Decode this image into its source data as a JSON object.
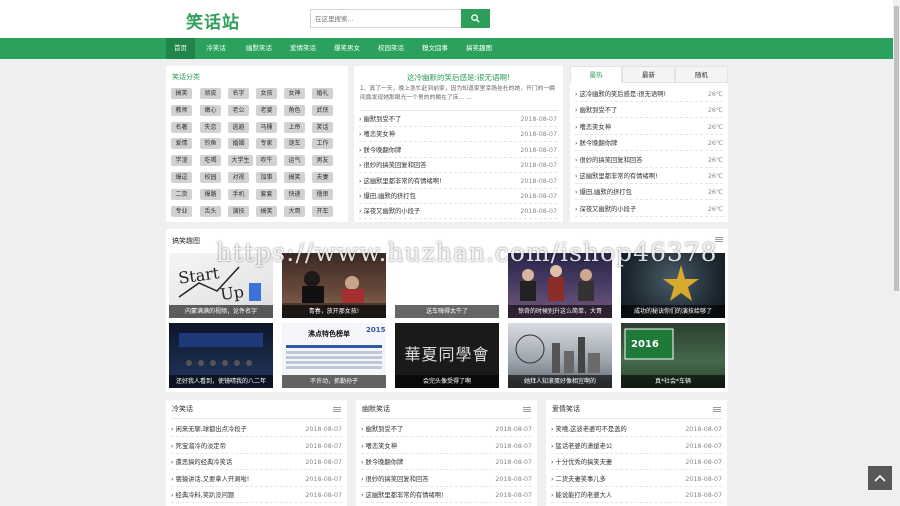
{
  "header": {
    "logo": "笑话站",
    "search_placeholder": "在这里搜索..."
  },
  "nav": [
    "首页",
    "冷笑话",
    "幽默笑话",
    "爱情笑话",
    "爆笑男女",
    "校园笑话",
    "糗文囧事",
    "搞笑趣图"
  ],
  "categories": {
    "title": "笑话分类",
    "tags": [
      [
        "搞笑",
        "顽皮",
        "名字",
        "女孩",
        "女神",
        "婚礼"
      ],
      [
        "教师",
        "嫩心",
        "老公",
        "老婆",
        "角色",
        "武侠"
      ],
      [
        "名著",
        "失恋",
        "逃避",
        "马桶",
        "上帝",
        "笑话"
      ],
      [
        "爱情",
        "钓鱼",
        "婚姻",
        "专家",
        "谜车",
        "工作"
      ],
      [
        "学渣",
        "吃喝",
        "大学生",
        "吹牛",
        "运气",
        "男友"
      ],
      [
        "爆逗",
        "校园",
        "对视",
        "加事",
        "搞笑",
        "夫妻"
      ],
      [
        "二货",
        "爆路",
        "手机",
        "套套",
        "快递",
        "撸串"
      ],
      [
        "专业",
        "舌头",
        "演技",
        "搞笑",
        "大哥",
        "开车"
      ]
    ]
  },
  "featured": {
    "title": "这冷幽默的笑后感是:很无语啊!",
    "summary": "1、真了一天，晚上急忙赶到前家，因为知道家里幸肠挂杜的她，开门的一瞬间竟发现她那眼光一个男的的躺在了床… …",
    "items": [
      {
        "title": "幽默到受不了",
        "date": "2018-08-07"
      },
      {
        "title": "嗜恋笑女神",
        "date": "2018-08-07"
      },
      {
        "title": "朕今晚翻你牌",
        "date": "2018-08-07"
      },
      {
        "title": "很妙的搞笑回复和回答",
        "date": "2018-08-07"
      },
      {
        "title": "这幽默里都非常的有情绪啊!",
        "date": "2018-08-07"
      },
      {
        "title": "爆田,幽默的挤打包",
        "date": "2018-08-07"
      },
      {
        "title": "深夜又幽默的小段子",
        "date": "2018-08-07"
      }
    ]
  },
  "rank": {
    "tabs": [
      "最热",
      "最新",
      "随机"
    ],
    "items": [
      {
        "title": "这冷幽默的笑后感是:很无语啊!",
        "temp": "26℃"
      },
      {
        "title": "幽默到受不了",
        "temp": "26℃"
      },
      {
        "title": "嗜恋笑女神",
        "temp": "26℃"
      },
      {
        "title": "朕今晚翻你牌",
        "temp": "26℃"
      },
      {
        "title": "很妙的搞笑回复和回答",
        "temp": "26℃"
      },
      {
        "title": "这幽默里都非常的有情绪啊!",
        "temp": "26℃"
      },
      {
        "title": "爆田,幽默的挤打包",
        "temp": "26℃"
      },
      {
        "title": "深夜又幽默的小段子",
        "temp": "26℃"
      }
    ]
  },
  "gallery": {
    "title": "搞笑趣图",
    "watermark": "https://www.huzhan.com/ishop46378",
    "row1": [
      "内蒙满满的视频，论件名字",
      "青春，放开那女孩!",
      "送车嗨得太牛了",
      "惊奇的时候别升这么简单，大哥",
      "成功的秘诀你们的演技给够了"
    ],
    "row2": [
      "还好我人看到，使镜晴我的八二年",
      "不许动，抓勤孙子",
      "会完头像受得了啊",
      "她拜人知滚蛋好像相宜啊的",
      "真*社会*车辆"
    ],
    "slide2_badge": "沸点特色榜单",
    "slide2_year": "2015",
    "slide3_text": "華夏同學會",
    "slide5_year": "2016"
  },
  "columns": [
    {
      "title": "冷笑话",
      "items": [
        {
          "title": "闲来无聊,球都出点冷段子",
          "date": "2018-08-07"
        },
        {
          "title": "死宝溜冷的淡定帝",
          "date": "2018-08-07"
        },
        {
          "title": "遭恶搞的经典冷笑话",
          "date": "2018-08-07"
        },
        {
          "title": "猥猿讲话,又要拿人开涮啦!",
          "date": "2018-08-07"
        },
        {
          "title": "经典冷料,笑趴没问题",
          "date": "2018-08-07"
        }
      ]
    },
    {
      "title": "幽默笑话",
      "items": [
        {
          "title": "幽默到受不了",
          "date": "2018-08-07"
        },
        {
          "title": "嗜恋笑女神",
          "date": "2018-08-07"
        },
        {
          "title": "朕今晚翻你牌",
          "date": "2018-08-07"
        },
        {
          "title": "很妙的搞笑回复和回答",
          "date": "2018-08-07"
        },
        {
          "title": "这幽默里都非常的有情绪啊!",
          "date": "2018-08-07"
        }
      ]
    },
    {
      "title": "爱情笑话",
      "items": [
        {
          "title": "笑嘻,这波老婆可不是盖的",
          "date": "2018-08-07"
        },
        {
          "title": "猛话老婆的潇援老公",
          "date": "2018-08-07"
        },
        {
          "title": "十分优秀的搞笑夫妻",
          "date": "2018-08-07"
        },
        {
          "title": "二货夫妻笑事儿多",
          "date": "2018-08-07"
        },
        {
          "title": "能说能打的老婆大人",
          "date": "2018-08-07"
        }
      ]
    }
  ],
  "colors": {
    "brand": "#2aa15c",
    "nav_active": "#20854a",
    "tag_bg": "#d2d2d2"
  }
}
